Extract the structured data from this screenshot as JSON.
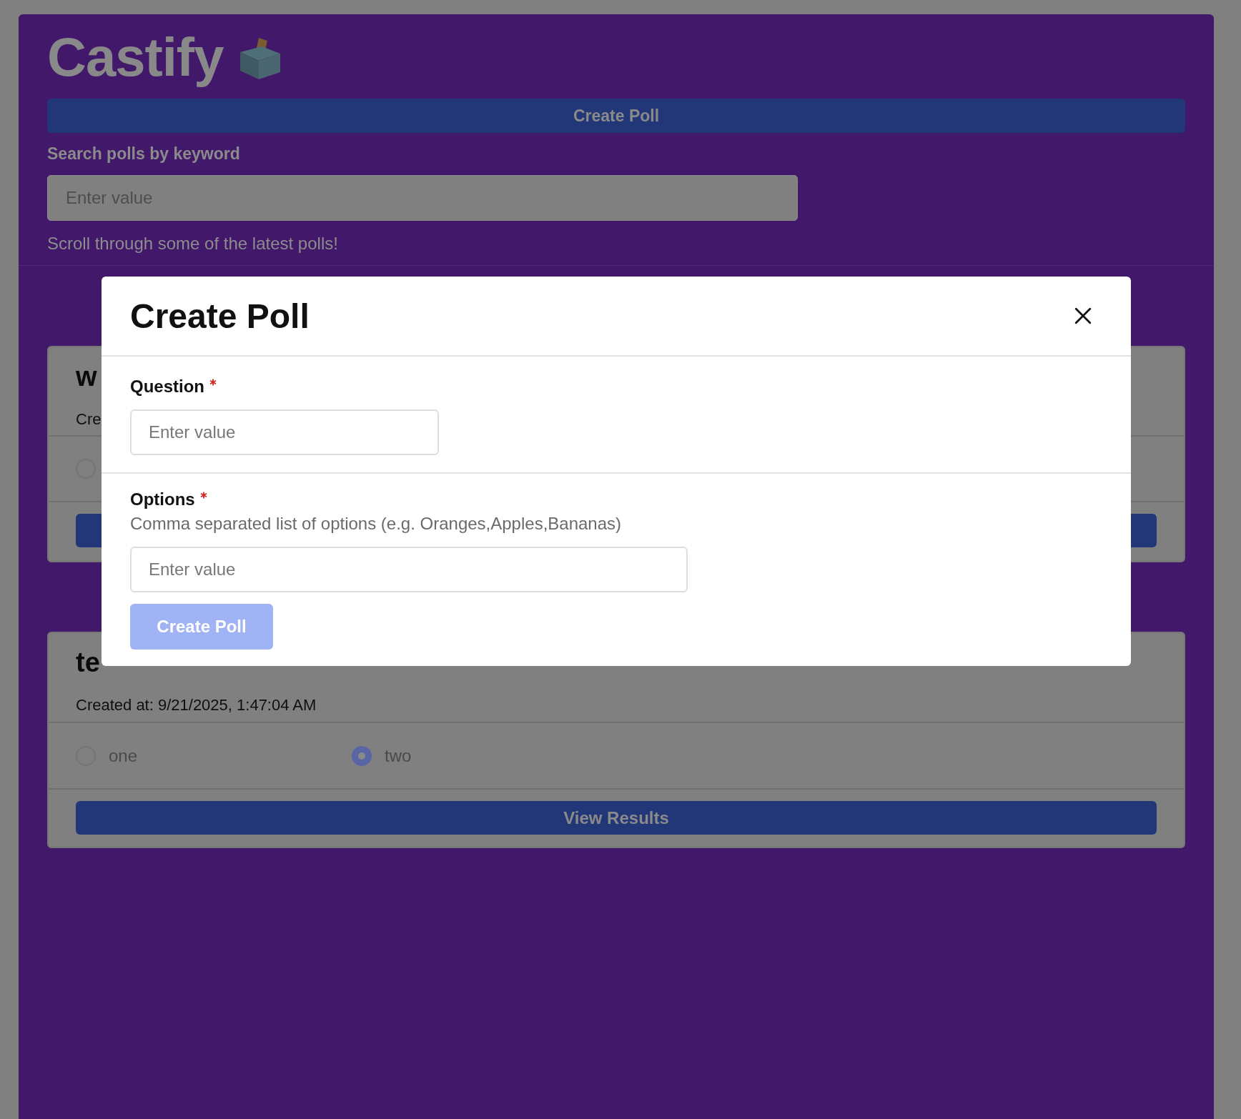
{
  "app": {
    "title": "Castify"
  },
  "create_button": {
    "label": "Create Poll"
  },
  "search": {
    "label": "Search polls by keyword",
    "placeholder": "Enter value"
  },
  "intro": "Scroll through some of the latest polls!",
  "polls": [
    {
      "title": "w",
      "created": "Cre",
      "options": [
        {
          "selected": false
        }
      ]
    },
    {
      "title": "te",
      "created": "Created at: 9/21/2025, 1:47:04 AM",
      "options": [
        {
          "label": "one",
          "selected": false
        },
        {
          "label": "two",
          "selected": true
        }
      ],
      "button": "View Results"
    }
  ],
  "modal": {
    "title": "Create Poll",
    "fields": [
      {
        "label": "Question",
        "required": true,
        "placeholder": "Enter value",
        "wide": false
      },
      {
        "label": "Options",
        "required": true,
        "hint": "Comma separated list of options (e.g. Oranges,Apples,Bananas)",
        "placeholder": "Enter value",
        "wide": true
      }
    ],
    "submit": {
      "label": "Create Poll",
      "disabled": true
    }
  }
}
